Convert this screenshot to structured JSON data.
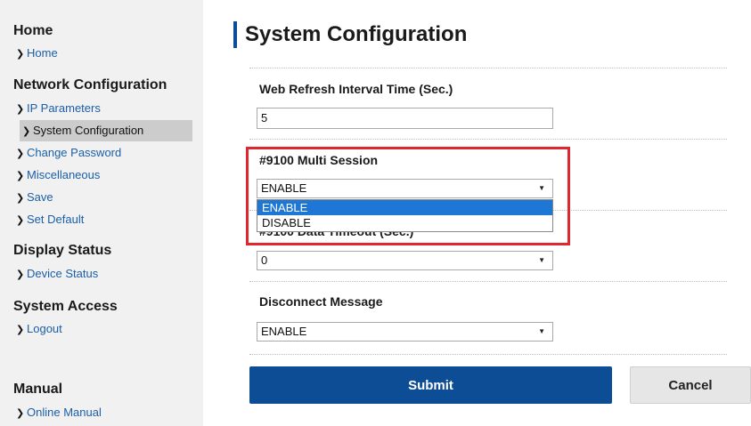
{
  "sidebar": {
    "sections": [
      {
        "title": "Home",
        "items": [
          {
            "label": "Home"
          }
        ]
      },
      {
        "title": "Network Configuration",
        "items": [
          {
            "label": "IP Parameters"
          },
          {
            "label": "System Configuration"
          },
          {
            "label": "Change Password"
          },
          {
            "label": "Miscellaneous"
          },
          {
            "label": "Save"
          },
          {
            "label": "Set Default"
          }
        ]
      },
      {
        "title": "Display Status",
        "items": [
          {
            "label": "Device Status"
          }
        ]
      },
      {
        "title": "System Access",
        "items": [
          {
            "label": "Logout"
          }
        ]
      },
      {
        "title": "Manual",
        "items": [
          {
            "label": "Online Manual"
          }
        ]
      }
    ],
    "active_item": "System Configuration"
  },
  "main": {
    "title": "System Configuration",
    "fields": {
      "web_refresh": {
        "label": "Web Refresh Interval Time (Sec.)",
        "value": "5"
      },
      "multi_session": {
        "label": "#9100 Multi Session",
        "value": "ENABLE",
        "options": [
          "ENABLE",
          "DISABLE"
        ],
        "highlighted_option": "ENABLE"
      },
      "data_timeout": {
        "label": "#9100 Data Timeout (Sec.)",
        "value": "0"
      },
      "disconnect_message": {
        "label": "Disconnect Message",
        "value": "ENABLE"
      }
    },
    "buttons": {
      "submit": "Submit",
      "cancel": "Cancel"
    }
  },
  "colors": {
    "accent": "#0d4d95",
    "highlight_border": "#e0262e",
    "selected_option": "#1e77d4",
    "sidebar_bg": "#f1f1f1"
  }
}
